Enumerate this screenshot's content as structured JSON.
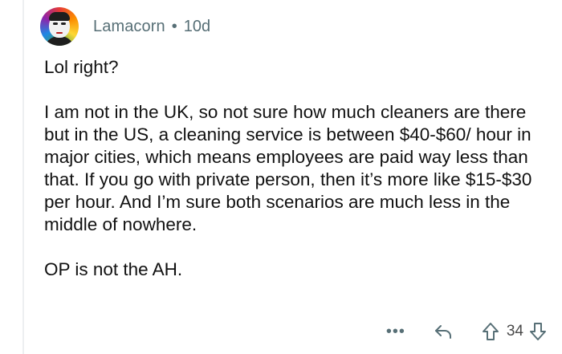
{
  "comment": {
    "username": "Lamacorn",
    "separator": "•",
    "age": "10d",
    "paragraphs": [
      "Lol right?",
      "I am not in the UK, so not sure how much cleaners are there but in the US, a cleaning service is between $40-$60/ hour in major cities, which means employees are paid way less than that.  If you go with private person, then it’s more like $15-$30 per hour. And I’m sure both scenarios are much less in the middle of nowhere.",
      "OP is not the AH."
    ],
    "score": "34"
  },
  "actions": {
    "more": "•••",
    "icons": [
      "more-icon",
      "reply-icon",
      "upvote-icon",
      "downvote-icon"
    ]
  },
  "colors": {
    "meta": "#576f76",
    "text": "#111111",
    "thread_line": "#edeff1"
  }
}
